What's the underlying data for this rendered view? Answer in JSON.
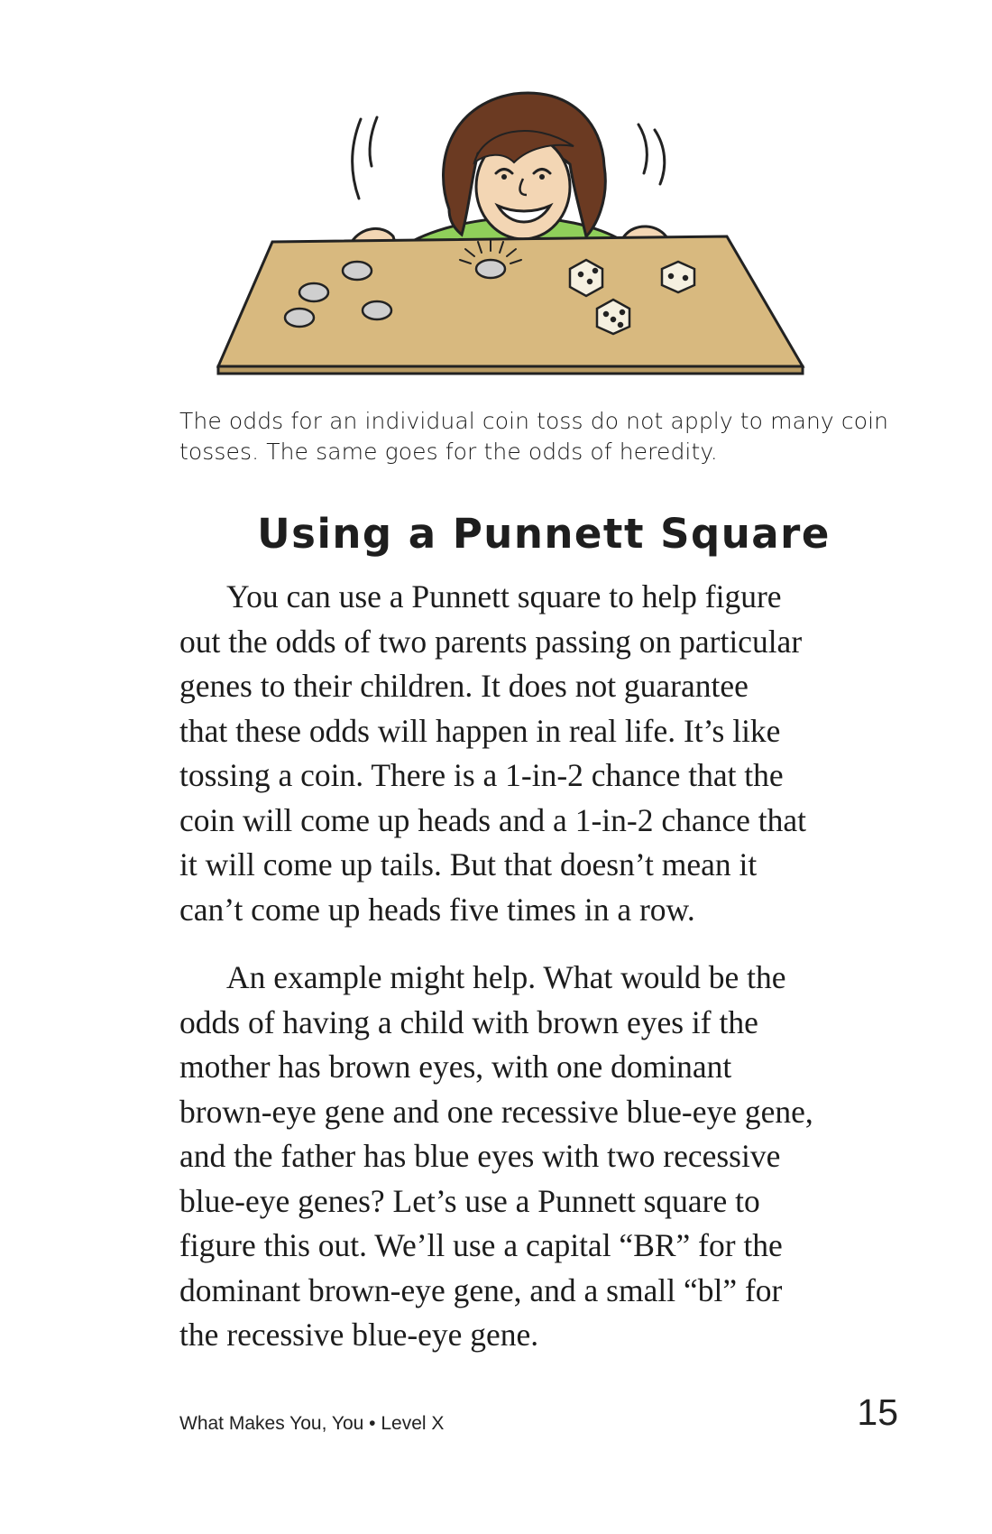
{
  "illustration": {
    "description_icon": "girl-with-coins-and-dice-illustration"
  },
  "caption": {
    "lines": [
      "The odds for an individual coin toss do not apply to many coin",
      "tosses. The same goes for the odds of heredity."
    ]
  },
  "section": {
    "heading": "Using a Punnett Square"
  },
  "paragraphs": [
    {
      "lines": [
        "You can use a Punnett square to help figure",
        "out the odds of two parents passing on particular",
        "genes to their children. It does not guarantee",
        "that these odds will happen in real life. It’s like",
        "tossing a coin. There is a 1-in-2 chance that the",
        "coin will come up heads and a 1-in-2 chance that",
        "it will come up tails. But that doesn’t mean it",
        "can’t come up heads five times in a row."
      ]
    },
    {
      "lines": [
        "An example might help. What would be the",
        "odds of having a child with brown eyes if the",
        "mother has brown eyes, with one dominant",
        "brown-eye gene and one recessive blue-eye gene,",
        "and the father has blue eyes with two recessive",
        "blue-eye genes? Let’s use a Punnett square to",
        "figure this out. We’ll use a capital “BR” for the",
        "dominant brown-eye gene, and a small “bl” for",
        "the recessive blue-eye gene."
      ]
    }
  ],
  "footer": {
    "book_title": "What Makes You, You • Level X",
    "page_number": "15"
  },
  "colors": {
    "table": "#d8b97f",
    "table_edge": "#b89a63",
    "hair": "#6b3a22",
    "skin": "#f3d6b4",
    "shirt": "#8fcf5a",
    "text": "#1c1c1c"
  }
}
